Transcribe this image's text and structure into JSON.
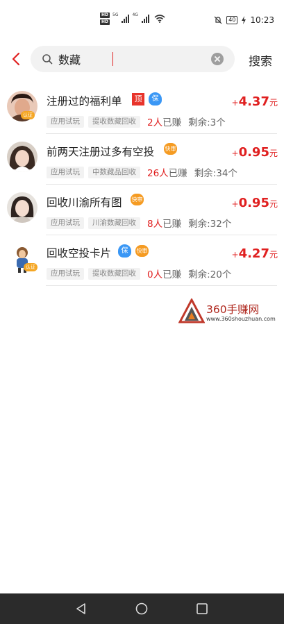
{
  "status_bar": {
    "hd1": "HD",
    "hd2": "HD",
    "sig1": "5G",
    "sig2": "4G",
    "battery": "40",
    "time": "10:23"
  },
  "search": {
    "query": "数藏",
    "search_button": "搜索"
  },
  "colors": {
    "accent": "#e02020",
    "guarantee": "#3a97f5",
    "fast": "#f59b22",
    "top_badge": "#e8342b"
  },
  "tasks": [
    {
      "title": "注册过的福利单",
      "badges": [
        "顶",
        "保"
      ],
      "tag1": "应用试玩",
      "tag2": "提收数藏回收",
      "earned_count": "2人",
      "earned_suffix": "已赚",
      "remaining": "剩余:3个",
      "price_sign": "+",
      "price": "4.37",
      "unit": "元",
      "avatar_badge": "认证"
    },
    {
      "title": "前两天注册过多有空投",
      "badges": [
        "快审"
      ],
      "tag1": "应用试玩",
      "tag2": "中数藏品回收",
      "earned_count": "26人",
      "earned_suffix": "已赚",
      "remaining": "剩余:34个",
      "price_sign": "+",
      "price": "0.95",
      "unit": "元"
    },
    {
      "title": "回收川渝所有图",
      "badges": [
        "快审"
      ],
      "tag1": "应用试玩",
      "tag2": "川渝数藏回收",
      "earned_count": "8人",
      "earned_suffix": "已赚",
      "remaining": "剩余:32个",
      "price_sign": "+",
      "price": "0.95",
      "unit": "元"
    },
    {
      "title": "回收空投卡片",
      "badges": [
        "保",
        "快审"
      ],
      "tag1": "应用试玩",
      "tag2": "提收数藏回收",
      "earned_count": "0人",
      "earned_suffix": "已赚",
      "remaining": "剩余:20个",
      "price_sign": "+",
      "price": "4.27",
      "unit": "元",
      "avatar_badge": "认证"
    }
  ],
  "watermark": {
    "name": "360手赚网",
    "url": "www.360shouzhuan.com"
  },
  "nav": {
    "back": "back-icon",
    "home": "home-icon",
    "recents": "recents-icon"
  }
}
